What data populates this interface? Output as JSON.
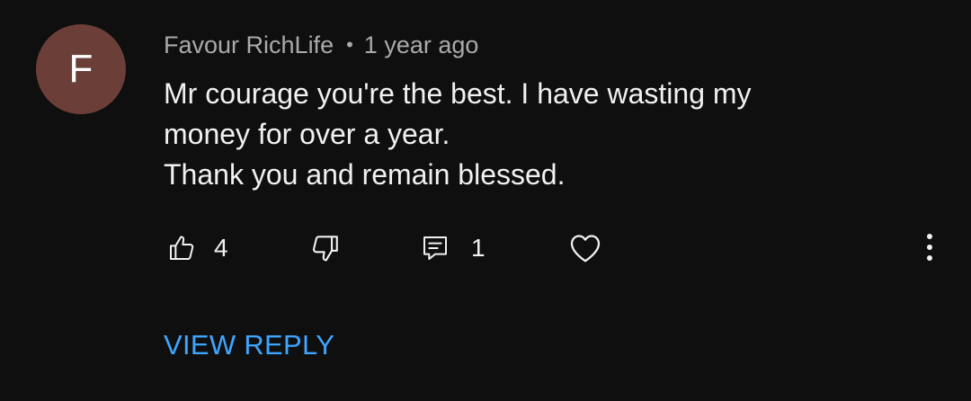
{
  "comment": {
    "author_initial": "F",
    "avatar_color": "#6b3f37",
    "author_name": "Favour RichLife",
    "separator": "•",
    "timestamp": "1 year ago",
    "text_lines": [
      "Mr courage you're the best. I have wasting my",
      "money for over a year.",
      "Thank you and remain blessed."
    ]
  },
  "actions": {
    "like_icon": "thumbs-up-icon",
    "like_count": "4",
    "dislike_icon": "thumbs-down-icon",
    "reply_icon": "comment-icon",
    "reply_count": "1",
    "heart_icon": "heart-icon",
    "more_icon": "more-vertical-icon"
  },
  "view_reply_label": "VIEW REPLY",
  "colors": {
    "background": "#0f0f0f",
    "primary_text": "#f1f1f1",
    "secondary_text": "#aaaaaa",
    "link": "#3ea6ff"
  }
}
